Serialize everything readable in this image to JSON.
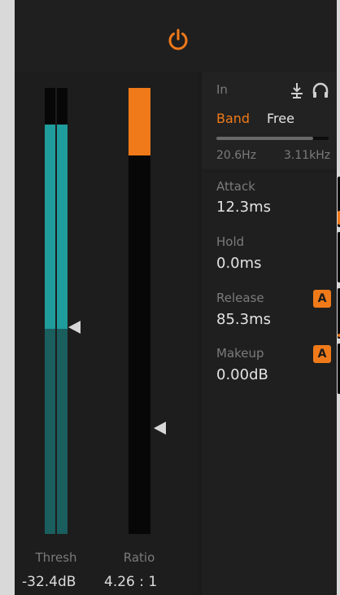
{
  "header": {
    "power_icon": "power-icon",
    "accent": "#f07a19"
  },
  "left": {
    "thresh_label": "Thresh",
    "thresh_value": "-32.4dB",
    "ratio_label": "Ratio",
    "ratio_value": "4.26 : 1",
    "thresh_meter_color": "#1f9c9c",
    "thresh_meter_below_color": "#1a5e5e"
  },
  "band": {
    "in_label": "In",
    "solo_icon": "listen-pin-icon",
    "headphones_icon": "headphones-icon",
    "band_label": "Band",
    "free_label": "Free",
    "freq_low": "20.6Hz",
    "freq_high": "3.11kHz"
  },
  "controls": [
    {
      "label": "Attack",
      "value": "12.3ms",
      "auto": ""
    },
    {
      "label": "Hold",
      "value": "0.0ms",
      "auto": ""
    },
    {
      "label": "Release",
      "value": "85.3ms",
      "auto": "A"
    },
    {
      "label": "Makeup",
      "value": "0.00dB",
      "auto": "A"
    }
  ]
}
